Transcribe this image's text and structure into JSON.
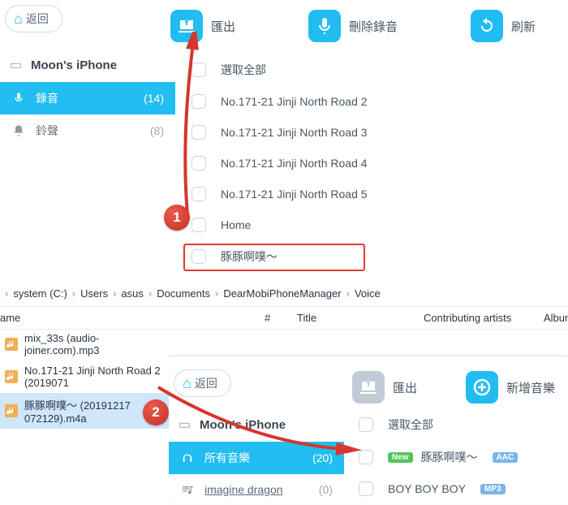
{
  "app1": {
    "back": "返回",
    "toolbar": {
      "export": "匯出",
      "delete": "刪除錄音",
      "refresh": "刷新"
    },
    "device": "Moon's iPhone",
    "sidebar": [
      {
        "icon": "mic-icon",
        "label": "錄音",
        "count": "(14)",
        "active": true
      },
      {
        "icon": "bell-icon",
        "label": "鈴聲",
        "count": "(8)",
        "active": false
      }
    ],
    "listHeader": "選取全部",
    "items": [
      "No.171-21 Jinji North Road 2",
      "No.171-21 Jinji North Road 3",
      "No.171-21 Jinji North Road 4",
      "No.171-21 Jinji North Road 5",
      "Home",
      "豚豚啊噗～"
    ]
  },
  "explorer": {
    "crumbs": [
      "system (C:)",
      "Users",
      "asus",
      "Documents",
      "DearMobiPhoneManager",
      "Voice"
    ],
    "cols": {
      "name": "ame",
      "num": "#",
      "title": "Title",
      "artists": "Contributing artists",
      "album": "Album"
    },
    "files": [
      "mix_33s (audio-joiner.com).mp3",
      "No.171-21 Jinji North Road 2 (2019071",
      "豚豚啊噗～ (20191217 072129).m4a"
    ]
  },
  "app2": {
    "back": "返回",
    "toolbar": {
      "export": "匯出",
      "add": "新增音樂"
    },
    "device": "Moon's iPhone",
    "sidebar": [
      {
        "icon": "headphones-icon",
        "label": "所有音樂",
        "count": "(20)",
        "active": true
      },
      {
        "icon": "note-icon",
        "label": "imagine dragon",
        "count": "(0)",
        "active": false
      }
    ],
    "listHeader": "選取全部",
    "tracks": [
      {
        "new": "New",
        "name": "豚豚啊噗～",
        "codec": "AAC"
      },
      {
        "new": "",
        "name": "BOY BOY BOY",
        "codec": "MP3"
      }
    ]
  },
  "callouts": {
    "one": "1",
    "two": "2"
  }
}
